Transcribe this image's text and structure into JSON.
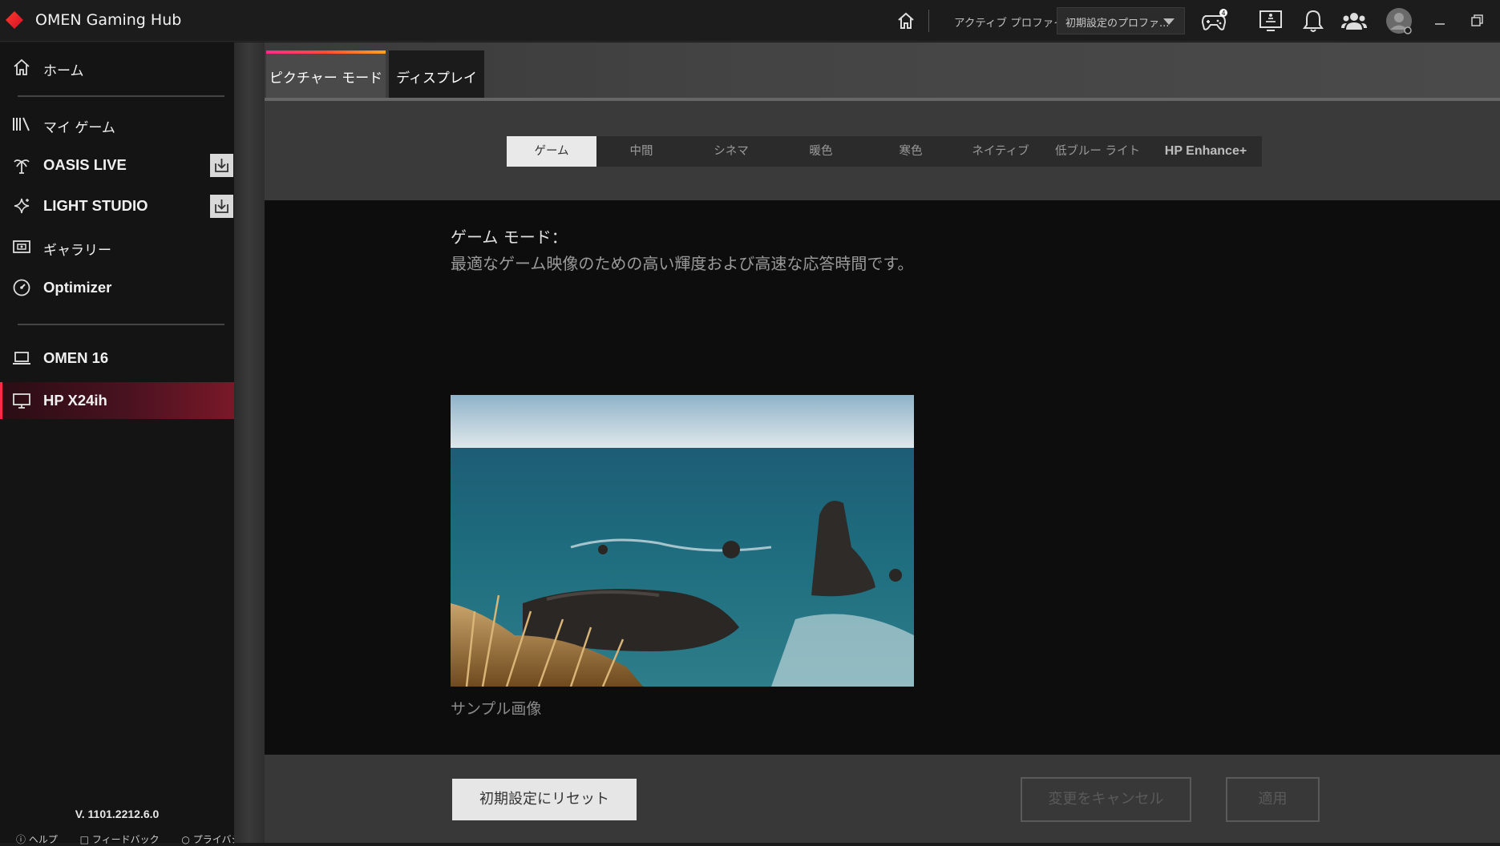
{
  "app": {
    "title": "OMEN Gaming Hub",
    "accent": "#ff2b46",
    "logo_icon": "omen-diamond-logo"
  },
  "titlebar": {
    "active_profile_label": "アクティブ プロファイル",
    "profile_value": "初期設定のプロファ...",
    "icons": [
      "home-icon",
      "controller-icon",
      "feedback-screen-icon",
      "bell-icon",
      "friends-icon",
      "avatar-icon",
      "minimize-icon",
      "restore-icon"
    ]
  },
  "sidebar": {
    "items": [
      {
        "label": "ホーム",
        "icon": "home-icon"
      },
      {
        "label": "マイ ゲーム",
        "icon": "library-icon"
      },
      {
        "label": "OASIS LIVE",
        "icon": "palm-tree-icon"
      },
      {
        "label": "LIGHT STUDIO",
        "icon": "sparkle-icon"
      },
      {
        "label": "ギャラリー",
        "icon": "gallery-icon"
      },
      {
        "label": "Optimizer",
        "icon": "gauge-icon"
      },
      {
        "label": "OMEN 16",
        "icon": "laptop-icon"
      },
      {
        "label": "HP X24ih",
        "icon": "monitor-icon"
      }
    ],
    "version": "V. 1101.2212.6.0",
    "footer": {
      "help": "ヘルプ",
      "feedback": "フィードバック",
      "privacy": "プライバシー"
    }
  },
  "tabs": [
    {
      "label": "ピクチャー モード"
    },
    {
      "label": "ディスプレイ"
    }
  ],
  "modes": [
    "ゲーム",
    "中間",
    "シネマ",
    "暖色",
    "寒色",
    "ネイティブ",
    "低ブルー ライト",
    "HP Enhance+"
  ],
  "selected_mode": "ゲーム",
  "detail": {
    "title": "ゲーム モード：",
    "description": "最適なゲーム映像のための高い輝度および高速な応答時間です。",
    "sample_caption": "サンプル画像"
  },
  "buttons": {
    "reset": "初期設定にリセット",
    "cancel": "変更をキャンセル",
    "apply": "適用"
  }
}
